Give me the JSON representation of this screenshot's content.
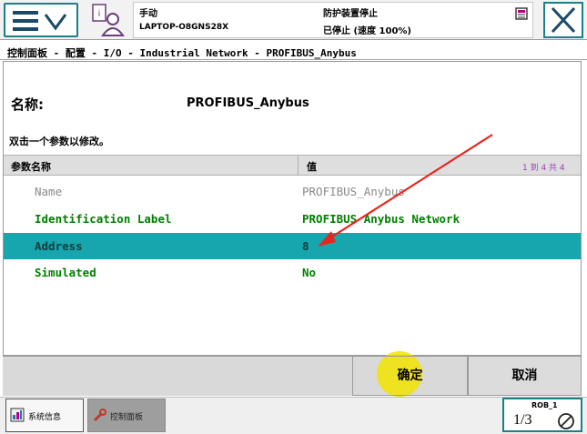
{
  "status": {
    "mode": "手动",
    "host": "LAPTOP-O8GNS28X",
    "safety": "防护装置停止",
    "run_state": "已停止 (速度 100%)"
  },
  "breadcrumb": "控制面板 - 配置 - I/O - Industrial Network - PROFIBUS_Anybus",
  "name_label": "名称:",
  "name_value": "PROFIBUS_Anybus",
  "instruction": "双击一个参数以修改。",
  "table": {
    "col_param": "参数名称",
    "col_value": "值",
    "count": "1 到 4 共 4",
    "rows": [
      {
        "name": "Name",
        "value": "PROFIBUS_Anybus"
      },
      {
        "name": "Identification Label",
        "value": "PROFIBUS Anybus Network"
      },
      {
        "name": "Address",
        "value": "8"
      },
      {
        "name": "Simulated",
        "value": "No"
      }
    ]
  },
  "buttons": {
    "ok": "确定",
    "cancel": "取消"
  },
  "taskbar": {
    "sysinfo": "系统信息",
    "control_panel": "控制面板",
    "robot": "ROB_1",
    "fraction": "1/3"
  },
  "colors": {
    "accent": "#1a7f8a",
    "selected_row": "#17a5ae",
    "value_green": "#008000",
    "arrow": "#e8261e"
  },
  "icons": [
    "menu-icon",
    "chevron-down-icon",
    "app-user-icon",
    "status-icon",
    "close-icon",
    "sysinfo-icon",
    "control-panel-icon",
    "speed-icon"
  ]
}
